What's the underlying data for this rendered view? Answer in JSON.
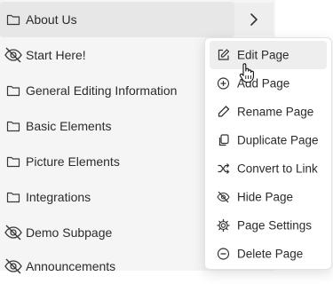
{
  "sidebar": {
    "pages": [
      {
        "label": "About Us",
        "icon": "folder-icon",
        "active": true
      },
      {
        "label": "Start Here!",
        "icon": "eye-off-icon"
      },
      {
        "label": "General Editing Information",
        "icon": "folder-icon"
      },
      {
        "label": "Basic Elements",
        "icon": "folder-icon"
      },
      {
        "label": "Picture Elements",
        "icon": "folder-icon"
      },
      {
        "label": "Integrations",
        "icon": "folder-icon"
      },
      {
        "label": "Demo Subpage",
        "icon": "eye-off-icon"
      },
      {
        "label": "Announcements",
        "icon": "eye-off-icon"
      }
    ],
    "expand_icon": "chevron-right-icon"
  },
  "context_menu": {
    "items": [
      {
        "label": "Edit Page",
        "icon": "edit-icon",
        "hovered": true
      },
      {
        "label": "Add Page",
        "icon": "plus-circle-icon"
      },
      {
        "label": "Rename Page",
        "icon": "pencil-icon"
      },
      {
        "label": "Duplicate Page",
        "icon": "duplicate-icon"
      },
      {
        "label": "Convert to Link",
        "icon": "shuffle-icon"
      },
      {
        "label": "Hide Page",
        "icon": "eye-off-icon"
      },
      {
        "label": "Page Settings",
        "icon": "gear-icon"
      },
      {
        "label": "Delete Page",
        "icon": "minus-circle-icon"
      }
    ]
  },
  "colors": {
    "sidebar_bg": "#f5f5f5",
    "active_row": "#e7e7e7",
    "menu_hover": "#eeeeee",
    "text": "#2b2b2b"
  }
}
